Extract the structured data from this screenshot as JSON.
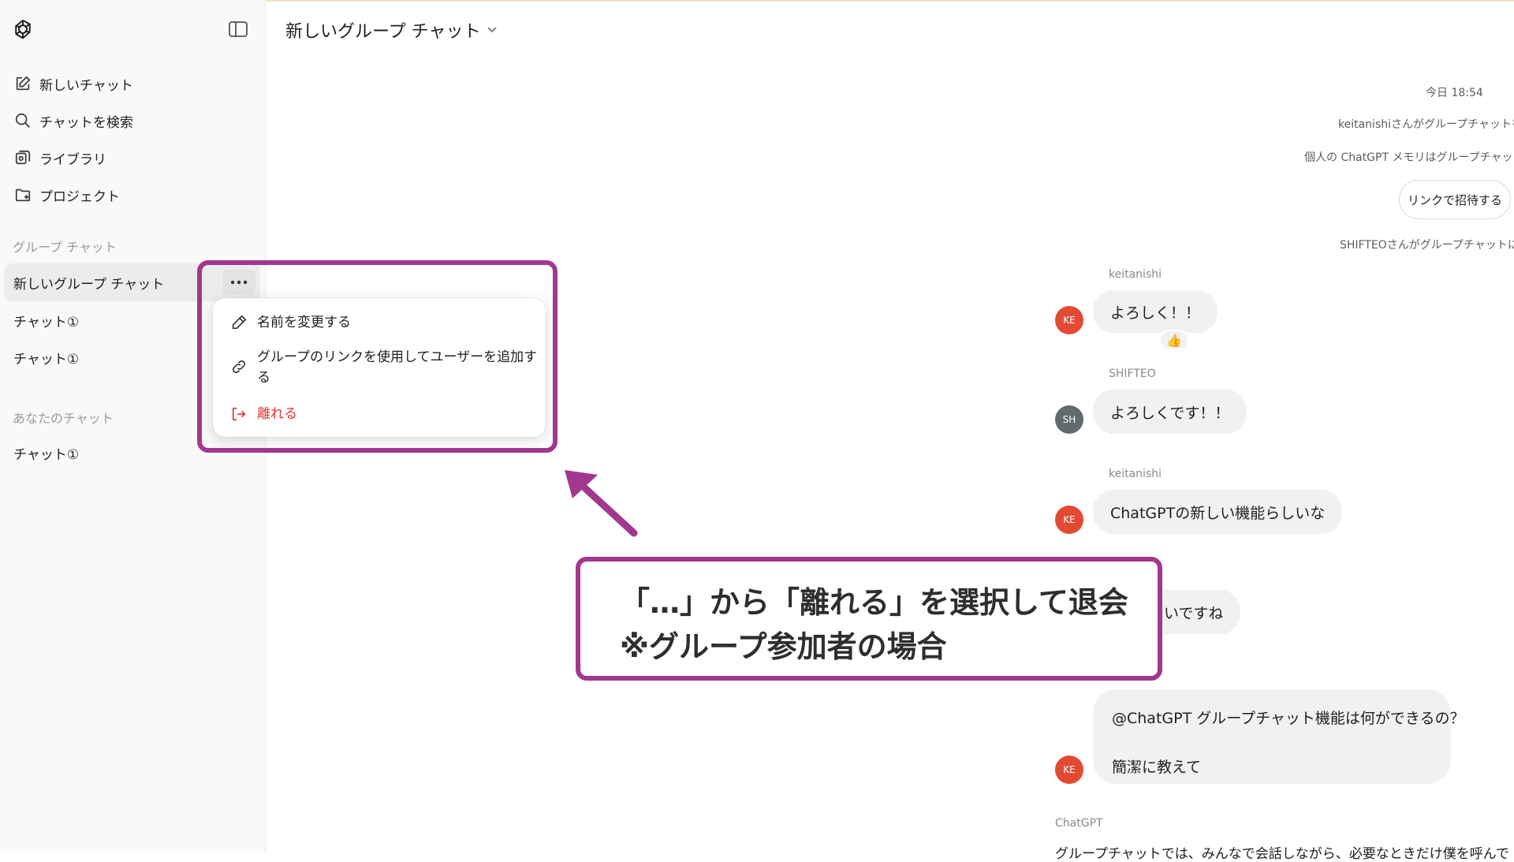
{
  "sidebar": {
    "nav": [
      {
        "label": "新しいチャット",
        "icon": "edit-icon"
      },
      {
        "label": "チャットを検索",
        "icon": "search-icon"
      },
      {
        "label": "ライブラリ",
        "icon": "library-icon"
      },
      {
        "label": "プロジェクト",
        "icon": "folder-icon"
      }
    ],
    "group_label": "グループ チャット",
    "group_chats": [
      "新しいグループ チャット",
      "チャット①",
      "チャット①"
    ],
    "your_label": "あなたのチャット",
    "your_chats": [
      "チャット①"
    ]
  },
  "context_menu": {
    "rename": "名前を変更する",
    "add_link_line1": "グループのリンクを使用してユーザーを追加す",
    "add_link_line2": "る",
    "leave": "離れる",
    "danger_color": "#e0362e"
  },
  "header": {
    "title": "新しいグループ チャット"
  },
  "chat": {
    "timestamp": "今日 18:54",
    "system_created": "keitanishiさんがグループチャットを作",
    "system_memory": "個人の ChatGPT メモリはグループチャットで",
    "invite_button": "リンクで招待する",
    "system_joined": "SHIFTEOさんがグループチャットに参",
    "messages": [
      {
        "sender": "keitanishi",
        "avatar": "KE",
        "text": "よろしく！！"
      },
      {
        "sender": "SHIFTEO",
        "avatar": "SH",
        "text": "よろしくです！！"
      },
      {
        "sender": "keitanishi",
        "avatar": "KE",
        "text": "ChatGPTの新しい機能らしいな"
      },
      {
        "sender": "",
        "avatar": "",
        "text": "いですね"
      },
      {
        "sender": "",
        "avatar": "KE",
        "text_line1": "@ChatGPT グループチャット機能は何ができるの？",
        "text_line2": "簡潔に教えて"
      }
    ],
    "reaction": "👍",
    "chatgpt_label": "ChatGPT",
    "chatgpt_partial": "グループチャットでは、みんなで会話しながら、必要なときだけ僕を呼んで"
  },
  "annotation": {
    "line1": "「…」から「離れる」を選択して退会",
    "line2": "※グループ参加者の場合",
    "accent": "#a2378f"
  },
  "colors": {
    "avatar_ke": "#e34a33",
    "avatar_sh": "#5f6b6d"
  }
}
